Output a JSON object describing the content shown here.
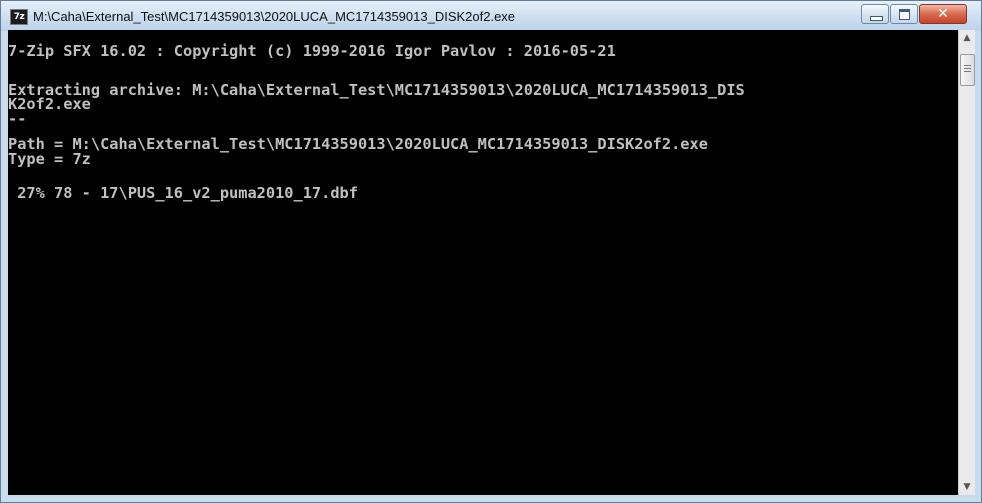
{
  "window": {
    "title": "M:\\Caha\\External_Test\\MC1714359013\\2020LUCA_MC1714359013_DISK2of2.exe",
    "app_icon_text": "7z"
  },
  "console": {
    "lines": [
      "7-Zip SFX 16.02 : Copyright (c) 1999-2016 Igor Pavlov : 2016-05-21",
      "Extracting archive: M:\\Caha\\External_Test\\MC1714359013\\2020LUCA_MC1714359013_DIS",
      "K2of2.exe",
      "--",
      "Path = M:\\Caha\\External_Test\\MC1714359013\\2020LUCA_MC1714359013_DISK2of2.exe",
      "Type = 7z",
      " 27% 78 - 17\\PUS_16_v2_puma2010_17.dbf"
    ]
  },
  "colors": {
    "console_bg": "#000000",
    "console_fg": "#c0c0c0",
    "frame": "#c9dcee",
    "close_button": "#c4422a"
  },
  "icons": {
    "minimize": "minimize-icon",
    "maximize": "maximize-icon",
    "close": "close-icon",
    "scroll_up": "chevron-up-icon",
    "scroll_down": "chevron-down-icon"
  }
}
